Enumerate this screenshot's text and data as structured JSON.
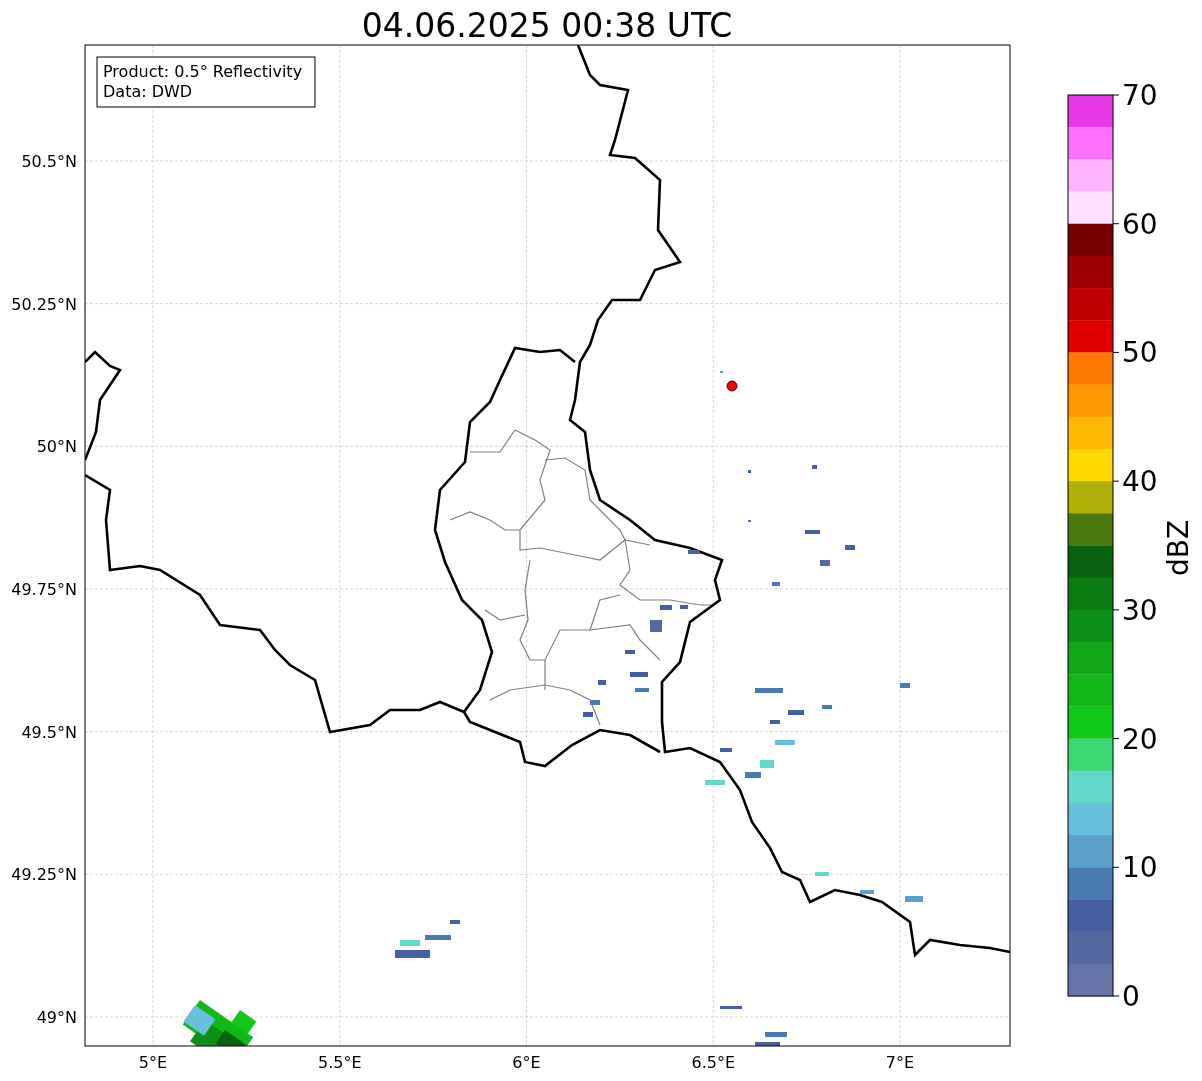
{
  "title": "04.06.2025 00:38 UTC",
  "info_box": [
    "Product: 0.5° Reflectivity",
    "Data: DWD"
  ],
  "map": {
    "lat_ticks": [
      "50.5°N",
      "50.25°N",
      "50°N",
      "49.75°N",
      "49.5°N",
      "49.25°N",
      "49°N"
    ],
    "lon_ticks": [
      "5°E",
      "5.5°E",
      "6°E",
      "6.5°E",
      "7°E"
    ]
  },
  "colorbar": {
    "label": "dBZ",
    "ticks": [
      "70",
      "60",
      "50",
      "40",
      "30",
      "20",
      "10",
      "0"
    ],
    "segments": [
      {
        "color": "#e838e8"
      },
      {
        "color": "#ff70ff"
      },
      {
        "color": "#ffb4ff"
      },
      {
        "color": "#ffe0ff"
      },
      {
        "color": "#780000"
      },
      {
        "color": "#a00000"
      },
      {
        "color": "#c00000"
      },
      {
        "color": "#e00000"
      },
      {
        "color": "#ff7800"
      },
      {
        "color": "#ff9800"
      },
      {
        "color": "#ffb800"
      },
      {
        "color": "#ffd800"
      },
      {
        "color": "#b0b008"
      },
      {
        "color": "#4a7a10"
      },
      {
        "color": "#08620e"
      },
      {
        "color": "#0a7c12"
      },
      {
        "color": "#0c9018"
      },
      {
        "color": "#10a818"
      },
      {
        "color": "#10b818"
      },
      {
        "color": "#10c818"
      },
      {
        "color": "#3cd874"
      },
      {
        "color": "#62d8c8"
      },
      {
        "color": "#68c0dc"
      },
      {
        "color": "#5aa0c8"
      },
      {
        "color": "#4a7ab0"
      },
      {
        "color": "#4460a0"
      },
      {
        "color": "#5468a0"
      },
      {
        "color": "#6674a8"
      }
    ]
  }
}
